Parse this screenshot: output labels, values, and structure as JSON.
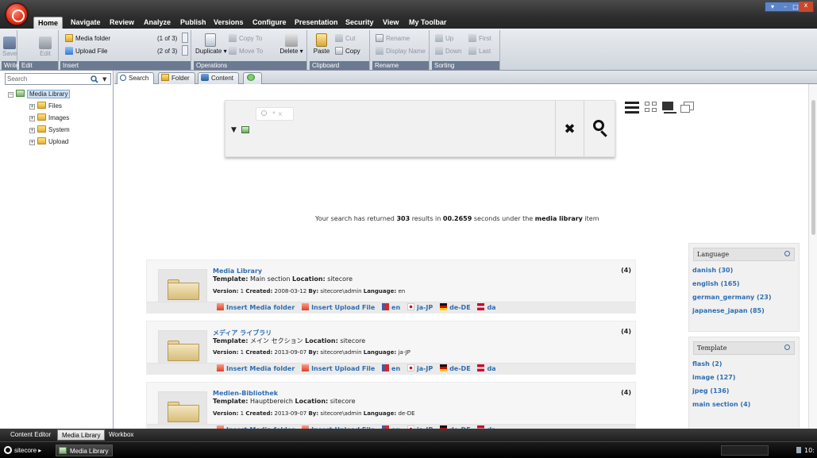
{
  "menu": {
    "tabs": [
      "Home",
      "Navigate",
      "Review",
      "Analyze",
      "Publish",
      "Versions",
      "Configure",
      "Presentation",
      "Security",
      "View",
      "My Toolbar"
    ],
    "active": "Home"
  },
  "ribbon": {
    "write": {
      "label": "Write",
      "save": "Save"
    },
    "edit": {
      "label": "Edit",
      "edit": "Edit"
    },
    "insert": {
      "label": "Insert",
      "media_folder": "Media folder",
      "media_folder_count": "(1 of 3)",
      "upload_file": "Upload File",
      "upload_file_count": "(2 of 3)"
    },
    "operations": {
      "label": "Operations",
      "duplicate": "Duplicate",
      "copy_to": "Copy To",
      "move_to": "Move To",
      "delete": "Delete"
    },
    "clipboard": {
      "label": "Clipboard",
      "paste": "Paste",
      "cut": "Cut",
      "copy": "Copy"
    },
    "rename": {
      "label": "Rename",
      "rename": "Rename",
      "display_name": "Display Name"
    },
    "sorting": {
      "label": "Sorting",
      "up": "Up",
      "down": "Down",
      "first": "First",
      "last": "Last"
    }
  },
  "left": {
    "search_placeholder": "Search",
    "tree": {
      "root": "Media Library",
      "children": [
        "Files",
        "Images",
        "System",
        "Upload"
      ]
    }
  },
  "content_tabs": [
    "Search",
    "Folder",
    "Content"
  ],
  "search": {
    "input_text": "*",
    "result_prefix": "Your search has returned",
    "result_count": "303",
    "result_mid": "results in",
    "result_time": "00.2659",
    "result_mid2": "seconds under the",
    "result_item": "media library",
    "result_suffix": "item"
  },
  "results": [
    {
      "title": "Media Library",
      "template_label": "Template:",
      "template": "Main section",
      "location_label": "Location:",
      "location": "sitecore",
      "version_label": "Version:",
      "version": "1",
      "created_label": "Created:",
      "created": "2008-03-12",
      "by_label": "By:",
      "by": "sitecore\\admin",
      "language_label": "Language:",
      "language": "en",
      "count": "(4)"
    },
    {
      "title": "メディア ライブラリ",
      "template_label": "Template:",
      "template": "メイン セクション",
      "location_label": "Location:",
      "location": "sitecore",
      "version_label": "Version:",
      "version": "1",
      "created_label": "Created:",
      "created": "2013-09-07",
      "by_label": "By:",
      "by": "sitecore\\admin",
      "language_label": "Language:",
      "language": "ja-JP",
      "count": "(4)"
    },
    {
      "title": "Medien-Bibliothek",
      "template_label": "Template:",
      "template": "Hauptbereich",
      "location_label": "Location:",
      "location": "sitecore",
      "version_label": "Version:",
      "version": "1",
      "created_label": "Created:",
      "created": "2013-09-07",
      "by_label": "By:",
      "by": "sitecore\\admin",
      "language_label": "Language:",
      "language": "de-DE",
      "count": "(4)"
    }
  ],
  "actions": {
    "insert_media_folder": "Insert Media folder",
    "insert_upload_file": "Insert Upload File",
    "en": "en",
    "ja": "ja-JP",
    "de": "de-DE",
    "da": "da"
  },
  "facets": {
    "language": {
      "title": "Language",
      "items": [
        "danish (30)",
        "english (165)",
        "german_germany (23)",
        "japanese_japan (85)"
      ]
    },
    "template": {
      "title": "Template",
      "items": [
        "flash (2)",
        "image (127)",
        "jpeg (136)",
        "main section (4)"
      ]
    }
  },
  "bottom_tabs": [
    "Content Editor",
    "Media Library",
    "Workbox"
  ],
  "taskbar": {
    "start": "sitecore",
    "window": "Media Library",
    "clock": "10:"
  },
  "colors": {
    "link": "#2f6eb2",
    "ribbon_group_label": "#6b7a90",
    "logo": "#e3321b"
  }
}
